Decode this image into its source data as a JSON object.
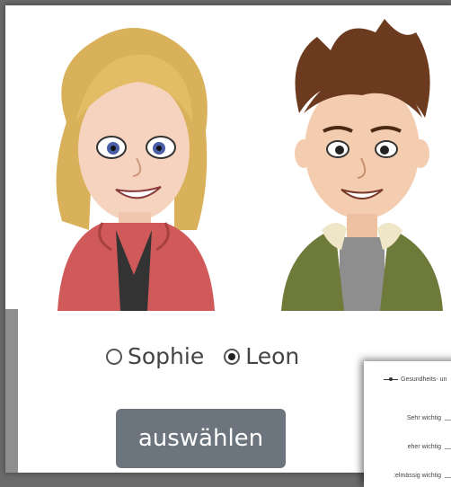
{
  "characters": {
    "options": [
      {
        "label": "Sophie",
        "selected": false
      },
      {
        "label": "Leon",
        "selected": true
      }
    ]
  },
  "action": {
    "label": "auswählen",
    "color": "#6c757d"
  },
  "chart": {
    "legend": "Gesundheits- un",
    "y_labels": [
      "Sehr wichtig",
      "eher wichtig",
      ":elmässig wichtig"
    ]
  }
}
